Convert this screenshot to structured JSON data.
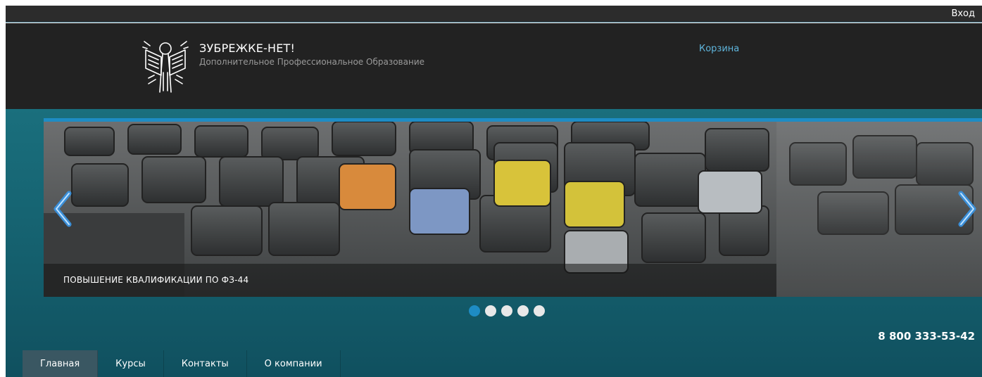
{
  "topbar": {
    "login_label": "Вход"
  },
  "header": {
    "title": "ЗУБРЕЖКЕ-НЕТ!",
    "subtitle": "Дополнительное Профессиональное Образование",
    "cart_label": "Корзина"
  },
  "slider": {
    "caption": "ПОВЫШЕНИЕ КВАЛИФИКАЦИИ ПО ФЗ-44",
    "dots": [
      {
        "active": true
      },
      {
        "active": false
      },
      {
        "active": false
      },
      {
        "active": false
      },
      {
        "active": false
      }
    ],
    "active_index": 0,
    "prev_icon": "chevron-left-icon",
    "next_icon": "chevron-right-icon"
  },
  "contact": {
    "phone": "8 800 333-53-42"
  },
  "nav": {
    "items": [
      {
        "label": "Главная",
        "active": true
      },
      {
        "label": "Курсы",
        "active": false
      },
      {
        "label": "Контакты",
        "active": false
      },
      {
        "label": "О компании",
        "active": false
      }
    ]
  },
  "colors": {
    "accent": "#1e8cc4",
    "link": "#5fb5dc",
    "header_bg": "#222222",
    "main_bg": "#176776"
  }
}
